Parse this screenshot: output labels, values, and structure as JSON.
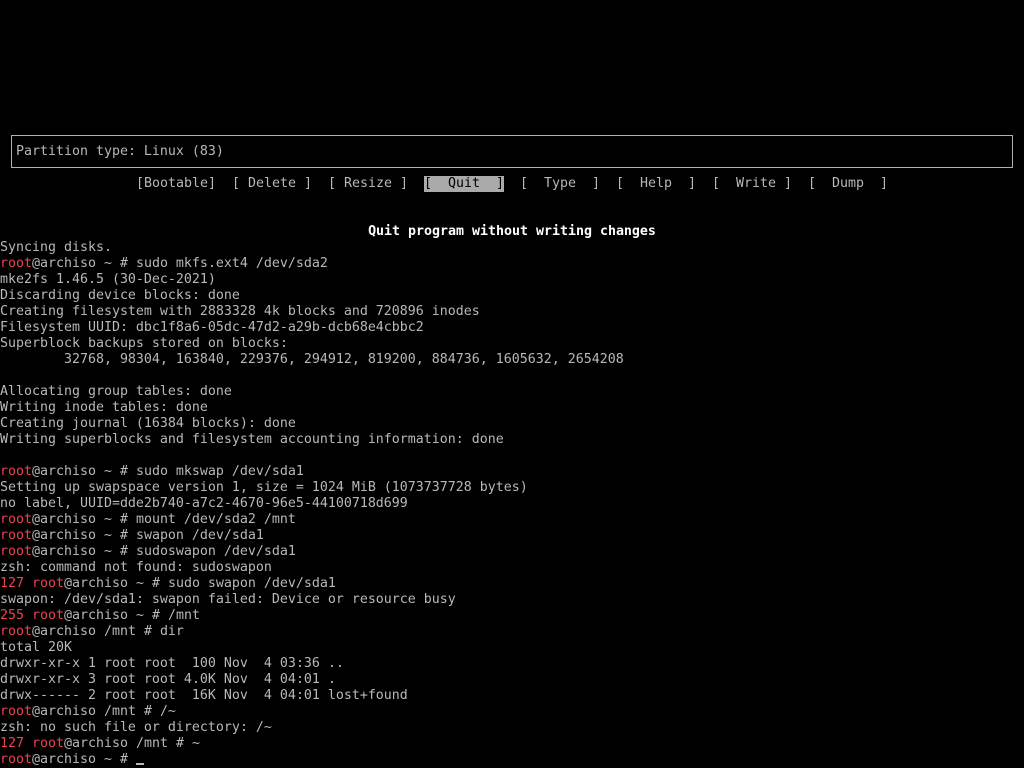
{
  "colors": {
    "background": "#000000",
    "text": "#b8b8b8",
    "bright_text": "#ffffff",
    "prompt_user": "#e8444e",
    "selected_background": "#aaaaaa",
    "selected_text": "#000000",
    "box_border": "#b0b0b0"
  },
  "cfdisk": {
    "partition_type": "Partition type: Linux (83)",
    "menu": [
      {
        "label": "[Bootable]",
        "selected": false
      },
      {
        "label": "[ Delete ]",
        "selected": false
      },
      {
        "label": "[ Resize ]",
        "selected": false
      },
      {
        "label": "[  Quit  ]",
        "selected": true
      },
      {
        "label": "[  Type  ]",
        "selected": false
      },
      {
        "label": "[  Help  ]",
        "selected": false
      },
      {
        "label": "[  Write ]",
        "selected": false
      },
      {
        "label": "[  Dump  ]",
        "selected": false
      }
    ],
    "hint": "Quit program without writing changes"
  },
  "terminal": {
    "lines": [
      {
        "text": "Syncing disks."
      },
      {
        "user": "root",
        "host": "@archiso",
        "cwd": "~",
        "symbol": "#",
        "command": "sudo mkfs.ext4 /dev/sda2"
      },
      {
        "text": "mke2fs 1.46.5 (30-Dec-2021)"
      },
      {
        "text": "Discarding device blocks: done"
      },
      {
        "text": "Creating filesystem with 2883328 4k blocks and 720896 inodes"
      },
      {
        "text": "Filesystem UUID: dbc1f8a6-05dc-47d2-a29b-dcb68e4cbbc2"
      },
      {
        "text": "Superblock backups stored on blocks:"
      },
      {
        "text": "\t32768, 98304, 163840, 229376, 294912, 819200, 884736, 1605632, 2654208"
      },
      {
        "text": ""
      },
      {
        "text": "Allocating group tables: done"
      },
      {
        "text": "Writing inode tables: done"
      },
      {
        "text": "Creating journal (16384 blocks): done"
      },
      {
        "text": "Writing superblocks and filesystem accounting information: done"
      },
      {
        "text": ""
      },
      {
        "user": "root",
        "host": "@archiso",
        "cwd": "~",
        "symbol": "#",
        "command": "sudo mkswap /dev/sda1"
      },
      {
        "text": "Setting up swapspace version 1, size = 1024 MiB (1073737728 bytes)"
      },
      {
        "text": "no label, UUID=dde2b740-a7c2-4670-96e5-44100718d699"
      },
      {
        "user": "root",
        "host": "@archiso",
        "cwd": "~",
        "symbol": "#",
        "command": "mount /dev/sda2 /mnt"
      },
      {
        "user": "root",
        "host": "@archiso",
        "cwd": "~",
        "symbol": "#",
        "command": "swapon /dev/sda1"
      },
      {
        "user": "root",
        "host": "@archiso",
        "cwd": "~",
        "symbol": "#",
        "command": "sudoswapon /dev/sda1"
      },
      {
        "text": "zsh: command not found: sudoswapon"
      },
      {
        "status": "127",
        "user": "root",
        "host": "@archiso",
        "cwd": "~",
        "symbol": "#",
        "command": "sudo swapon /dev/sda1"
      },
      {
        "text": "swapon: /dev/sda1: swapon failed: Device or resource busy"
      },
      {
        "status": "255",
        "user": "root",
        "host": "@archiso",
        "cwd": "~",
        "symbol": "#",
        "command": "/mnt"
      },
      {
        "user": "root",
        "host": "@archiso",
        "cwd": "/mnt",
        "symbol": "#",
        "command": "dir"
      },
      {
        "text": "total 20K"
      },
      {
        "text": "drwxr-xr-x 1 root root  100 Nov  4 03:36 .."
      },
      {
        "text": "drwxr-xr-x 3 root root 4.0K Nov  4 04:01 ."
      },
      {
        "text": "drwx------ 2 root root  16K Nov  4 04:01 lost+found"
      },
      {
        "user": "root",
        "host": "@archiso",
        "cwd": "/mnt",
        "symbol": "#",
        "command": "/~"
      },
      {
        "text": "zsh: no such file or directory: /~"
      },
      {
        "status": "127",
        "user": "root",
        "host": "@archiso",
        "cwd": "/mnt",
        "symbol": "#",
        "command": "~"
      },
      {
        "user": "root",
        "host": "@archiso",
        "cwd": "~",
        "symbol": "#",
        "command": "",
        "active": true
      }
    ]
  }
}
